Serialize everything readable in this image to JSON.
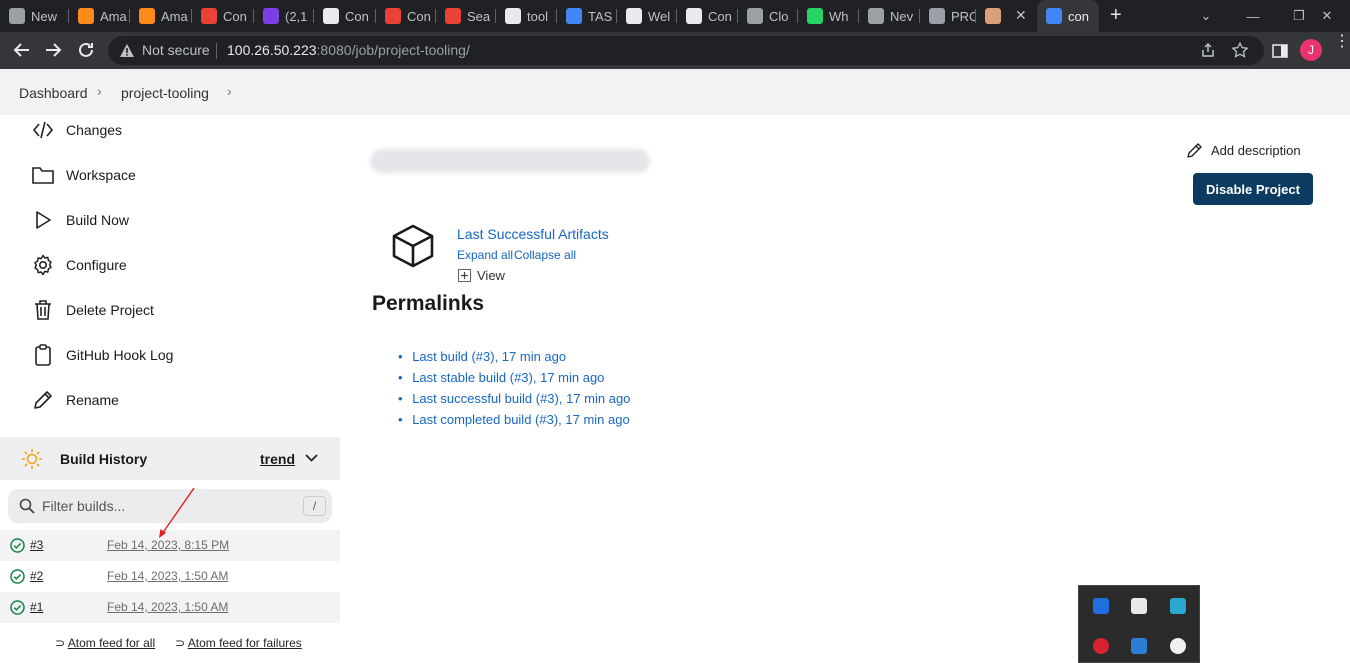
{
  "browser": {
    "tabs": [
      {
        "label": "New",
        "color": "#9aa0a6"
      },
      {
        "label": "Ama",
        "color": "#ff8c1a"
      },
      {
        "label": "Ama",
        "color": "#ff8c1a"
      },
      {
        "label": "Con",
        "color": "#ea4335"
      },
      {
        "label": "(2,1",
        "color": "#7b3fe4"
      },
      {
        "label": "Con",
        "color": "#e8eaed"
      },
      {
        "label": "Con",
        "color": "#ea4335"
      },
      {
        "label": "Sea",
        "color": "#ea4335"
      },
      {
        "label": "tool",
        "color": "#e8eaed"
      },
      {
        "label": "TAS",
        "color": "#4285f4"
      },
      {
        "label": "Wel",
        "color": "#e8eaed"
      },
      {
        "label": "Con",
        "color": "#e8eaed"
      },
      {
        "label": "Clo",
        "color": "#9aa0a6"
      },
      {
        "label": "Wh",
        "color": "#25d366"
      },
      {
        "label": "Nev",
        "color": "#9aa0a6"
      },
      {
        "label": "PRC",
        "color": "#9aa0a6"
      },
      {
        "label": "",
        "color": "#d9a07a"
      },
      {
        "label": "con",
        "color": "#4285f4"
      }
    ],
    "new_tab": "+",
    "security": "Not secure",
    "url_host": "100.26.50.223",
    "url_rest": ":8080/job/project-tooling/"
  },
  "breadcrumb": {
    "items": [
      "Dashboard",
      "project-tooling"
    ]
  },
  "sidebar": {
    "items": [
      {
        "label": "Changes",
        "icon": "code-icon"
      },
      {
        "label": "Workspace",
        "icon": "folder-icon"
      },
      {
        "label": "Build Now",
        "icon": "play-icon"
      },
      {
        "label": "Configure",
        "icon": "gear-icon"
      },
      {
        "label": "Delete Project",
        "icon": "trash-icon"
      },
      {
        "label": "GitHub Hook Log",
        "icon": "clipboard-icon"
      },
      {
        "label": "Rename",
        "icon": "pencil-icon"
      }
    ]
  },
  "build_history": {
    "title": "Build History",
    "trend_label": "trend",
    "filter_placeholder": "Filter builds...",
    "filter_shortcut": "/",
    "builds": [
      {
        "number": "#3",
        "date": "Feb 14, 2023, 8:15 PM"
      },
      {
        "number": "#2",
        "date": "Feb 14, 2023, 1:50 AM"
      },
      {
        "number": "#1",
        "date": "Feb 14, 2023, 1:50 AM"
      }
    ],
    "atom_all": "Atom feed for all",
    "atom_failures": "Atom feed for failures"
  },
  "main": {
    "add_description": "Add description",
    "disable_project": "Disable Project",
    "artifacts_title": "Last Successful Artifacts",
    "expand_all": "Expand all",
    "collapse_all": "Collapse all",
    "view_label": "View",
    "permalinks_heading": "Permalinks",
    "permalinks": [
      "Last build (#3), 17 min ago",
      "Last stable build (#3), 17 min ago",
      "Last successful build (#3), 17 min ago",
      "Last completed build (#3), 17 min ago"
    ]
  },
  "colors": {
    "link": "#1766c2",
    "primary_button": "#0b3b60",
    "success": "#138347"
  }
}
